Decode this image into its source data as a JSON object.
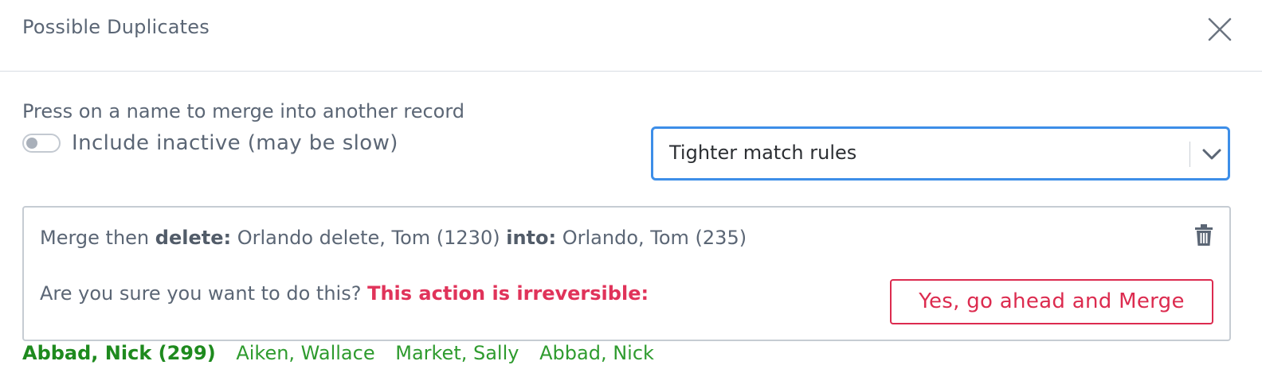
{
  "modal": {
    "title": "Possible Duplicates",
    "close_icon": "close-icon"
  },
  "hint": "Press on a name to merge into another record",
  "toggle": {
    "label": "Include inactive (may be slow)",
    "checked": false
  },
  "match_select": {
    "value": "Tighter match rules"
  },
  "merge": {
    "prefix": "Merge then",
    "delete_label": "delete:",
    "delete_record": "Orlando delete, Tom (1230)",
    "into_label": "into:",
    "into_record": "Orlando, Tom (235)",
    "question": "Are you sure you want to do this?",
    "warning": "This action is irreversible:",
    "confirm_button": "Yes, go ahead and Merge",
    "trash_icon": "trash-icon"
  },
  "duplicates": {
    "main": "Abbad, Nick (299)",
    "links": [
      "Aiken, Wallace",
      "Market, Sally",
      "Abbad, Nick"
    ]
  },
  "colors": {
    "accent": "#3d8ee8",
    "danger": "#dc2b4f",
    "success": "#1e8a1e",
    "text": "#5b6675"
  }
}
